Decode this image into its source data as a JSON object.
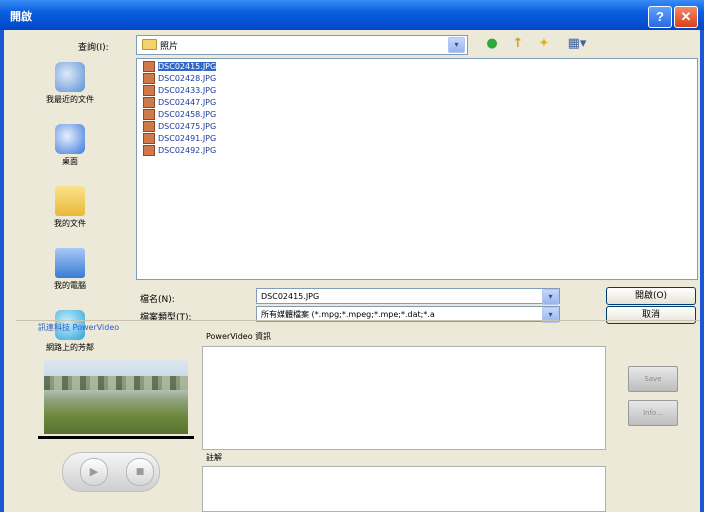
{
  "window": {
    "title": "開啟",
    "help": "?",
    "close": "✕"
  },
  "lookin": {
    "label": "查詢(I):",
    "value": "照片",
    "arrow": "▾"
  },
  "toolbar": {
    "back_icon": "●",
    "up_icon": "↑",
    "new_folder_icon": "✦",
    "view_icon": "▦▾"
  },
  "places": [
    {
      "label": "我最近的文件",
      "icon": "recent-docs-icon",
      "color": "#5b8fd8"
    },
    {
      "label": "桌面",
      "icon": "desktop-icon",
      "color": "#3c78d8"
    },
    {
      "label": "我的文件",
      "icon": "my-documents-icon",
      "color": "#f2c94c"
    },
    {
      "label": "我的電腦",
      "icon": "my-computer-icon",
      "color": "#3a7bd5"
    },
    {
      "label": "網路上的芳鄰",
      "icon": "network-places-icon",
      "color": "#2fa3d8"
    }
  ],
  "files": [
    "DSC02415.JPG",
    "DSC02428.JPG",
    "DSC02433.JPG",
    "DSC02447.JPG",
    "DSC02458.JPG",
    "DSC02475.JPG",
    "DSC02491.JPG",
    "DSC02492.JPG"
  ],
  "filename": {
    "label": "檔名(N):",
    "value": "DSC02415.JPG"
  },
  "filetype": {
    "label": "檔案類型(T):",
    "value": "所有媒體檔案 (*.mpg;*.mpeg;*.mpe;*.dat;*.a"
  },
  "buttons": {
    "open": "開啟(O)",
    "cancel": "取消"
  },
  "preview": {
    "tab_label": "訊連科技 PowerVideo",
    "info_label": "PowerVideo 資訊",
    "notes_label": "註解",
    "play_icon": "▶",
    "stop_icon": "■",
    "side_btn_1": "Save",
    "side_btn_2": "Info..."
  },
  "colors": {
    "titlebar": "#0a5fe0",
    "selection": "#316ac5",
    "frame": "#1a58d8"
  }
}
